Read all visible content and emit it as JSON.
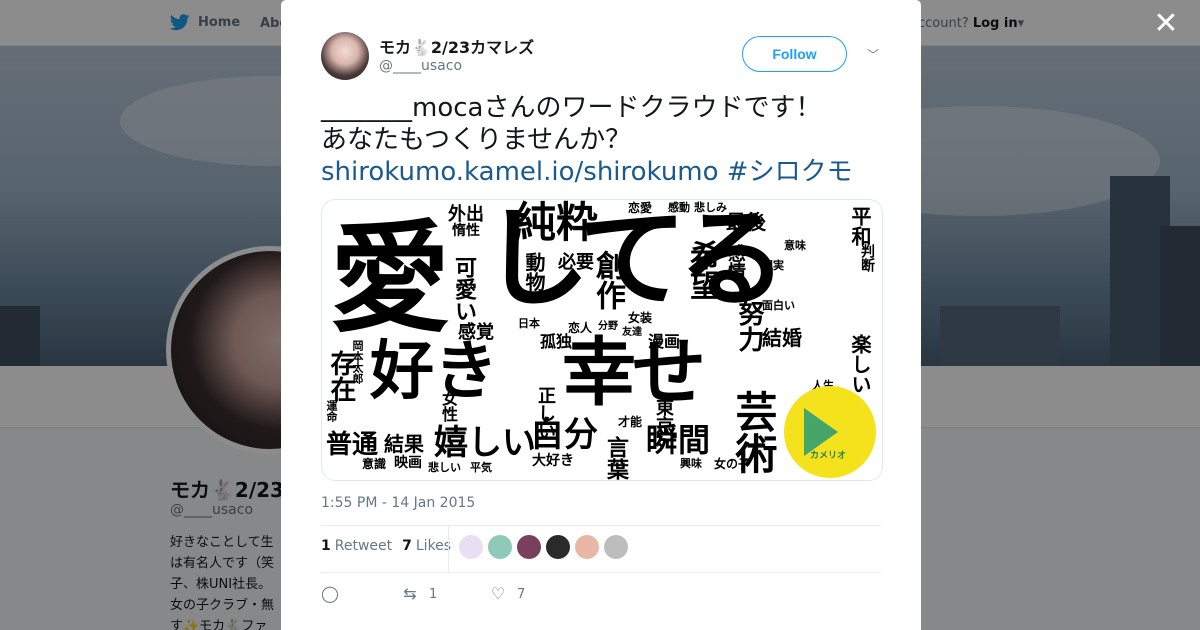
{
  "background": {
    "nav": {
      "home_label": "Home",
      "about_label": "Abo",
      "login_prompt": "account?",
      "login_label": "Log in"
    },
    "profile": {
      "name": "モカ🐇2/23",
      "handle": "@____usaco",
      "bio_lines": [
        "好きなことして生",
        "は有名人です（笑",
        "子、株UNI社長。",
        "女の子クラブ・無",
        "す✨モカ🐇ファ"
      ]
    }
  },
  "modal": {
    "close_icon": "close-icon",
    "author": {
      "name": "モカ🐇2/23カマレズ",
      "handle": "@____usaco"
    },
    "follow_label": "Follow",
    "tweet": {
      "line1": "_______mocaさんのワードクラウドです！",
      "line2": "あなたもつくりませんか？",
      "link": "shirokumo.kamel.io/shirokumo #シロクモ"
    },
    "wordcloud": {
      "logo_label": "カメリオ",
      "words": [
        "愛",
        "してる",
        "純粋",
        "好き",
        "幸せ",
        "嬉しい",
        "自分",
        "芸術",
        "存在",
        "普通",
        "結果",
        "瞬間",
        "希望",
        "努力",
        "創作",
        "可愛い",
        "感覚",
        "平和",
        "最後",
        "外出",
        "惰性",
        "動物",
        "必要",
        "感情",
        "言葉",
        "東京",
        "映画",
        "正しい",
        "女性",
        "孤独",
        "結婚",
        "楽しい",
        "漫画",
        "恋人",
        "意識",
        "大好き",
        "興味",
        "女の子",
        "才能",
        "判断",
        "岡本太郎",
        "運命",
        "悲しい",
        "平気",
        "感動",
        "悲しみ",
        "恋愛",
        "面白い",
        "現実",
        "意味",
        "人生",
        "日本",
        "女装",
        "分野",
        "友達"
      ]
    },
    "timestamp": "1:55 PM - 14 Jan 2015",
    "stats": {
      "retweets_count": "1",
      "retweets_label": "Retweet",
      "likes_count": "7",
      "likes_label": "Likes"
    },
    "actions": {
      "reply_count": "",
      "retweet_count": "1",
      "like_count": "7"
    },
    "colors": {
      "accent": "#1da1f2",
      "link": "#1b5a8e",
      "muted": "#657786"
    }
  }
}
